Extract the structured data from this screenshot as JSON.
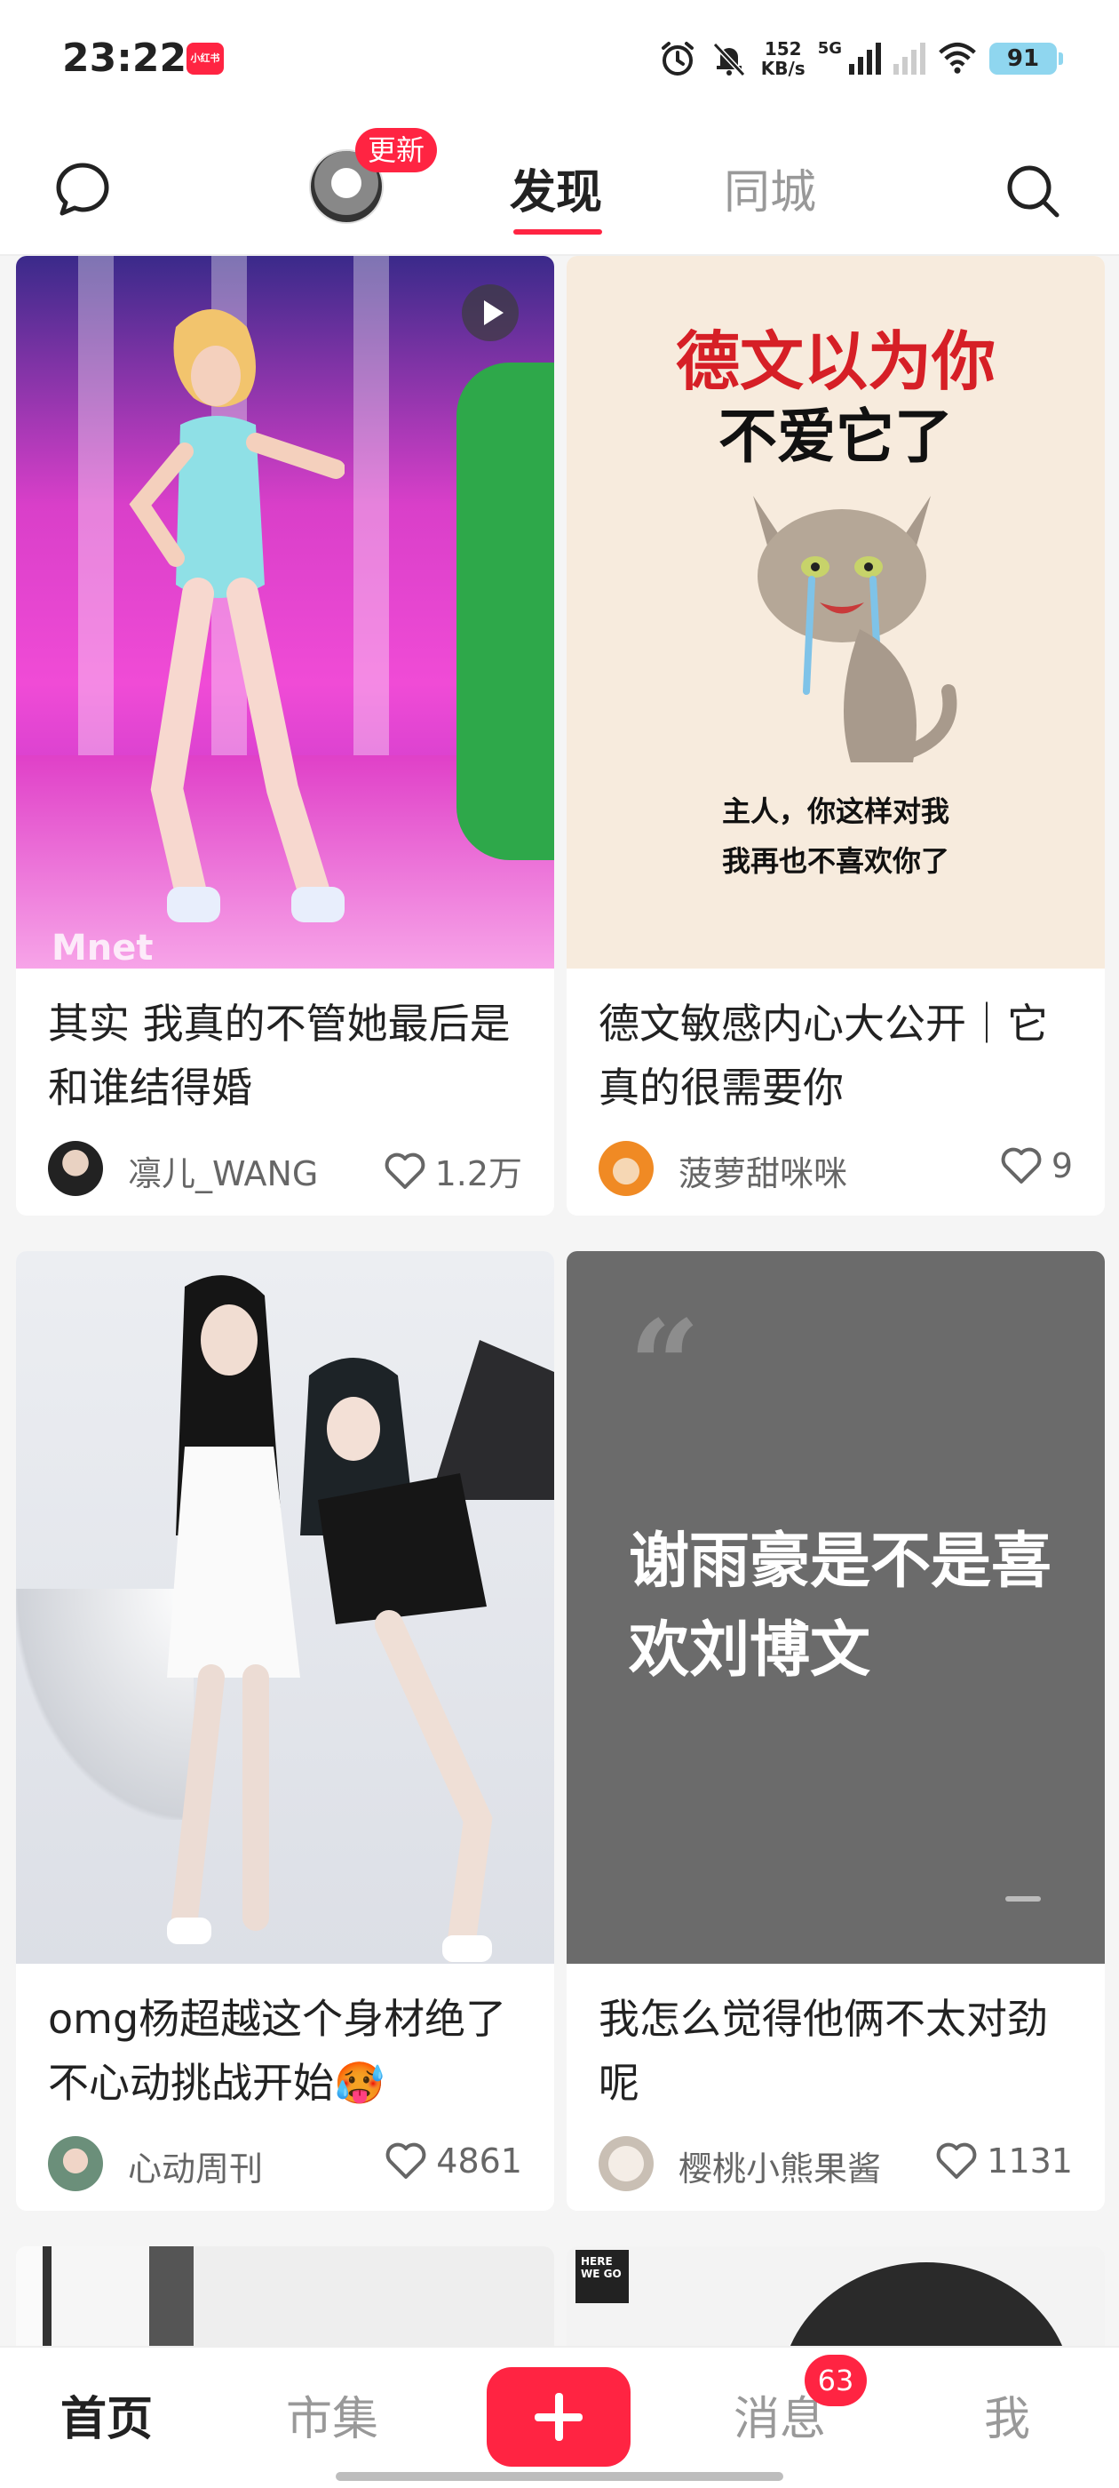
{
  "status_bar": {
    "time": "23:22",
    "app_badge": "小红书",
    "net_speed_value": "152",
    "net_speed_unit": "KB/s",
    "network": "5G",
    "battery": "91"
  },
  "top_nav": {
    "update_badge": "更新",
    "tabs": [
      {
        "label": "发现",
        "active": true
      },
      {
        "label": "同城",
        "active": false
      }
    ]
  },
  "feed": {
    "cards": [
      {
        "title": "其实 我真的不管她最后是和谁结得婚",
        "author": "凛儿_WANG",
        "likes": "1.2万",
        "is_video": true,
        "image_text": "Mnet"
      },
      {
        "title": "德文敏感内心大公开｜它真的很需要你",
        "author": "菠萝甜咪咪",
        "likes": "9",
        "image_lines": [
          "德文以为你",
          "不爱它了",
          "主人，你这样对我",
          "我再也不喜欢你了"
        ]
      },
      {
        "title": "omg杨超越这个身材绝了 不心动挑战开始🥵",
        "author": "心动周刊",
        "likes": "4861"
      },
      {
        "title": "我怎么觉得他俩不太对劲呢",
        "author": "樱桃小熊果酱",
        "likes": "1131",
        "quote_mark": "“",
        "quote_text": "谢雨豪是不是喜欢刘博文"
      }
    ],
    "partial_logo": "HERE WE GO"
  },
  "bottom_nav": {
    "home": "首页",
    "market": "市集",
    "messages": "消息",
    "messages_badge": "63",
    "me": "我"
  },
  "colors": {
    "accent": "#ff2442",
    "quote_bg": "#6b6b6b",
    "cat_bg": "#f7ebdd"
  }
}
